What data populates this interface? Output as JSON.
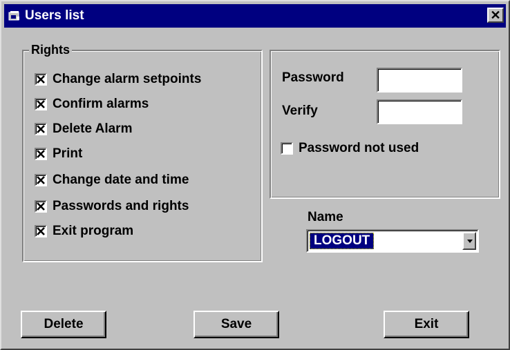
{
  "window": {
    "title": "Users list",
    "close_label": "✕",
    "title_icon": "window-app-icon"
  },
  "rights": {
    "legend": "Rights",
    "items": [
      {
        "label": "Change alarm setpoints",
        "checked": true
      },
      {
        "label": "Confirm alarms",
        "checked": true
      },
      {
        "label": "Delete Alarm",
        "checked": true
      },
      {
        "label": "Print",
        "checked": true
      },
      {
        "label": "Change date and time",
        "checked": true
      },
      {
        "label": "Passwords and rights",
        "checked": true
      },
      {
        "label": "Exit program",
        "checked": true
      }
    ]
  },
  "password": {
    "password_label": "Password",
    "password_value": "",
    "verify_label": "Verify",
    "verify_value": "",
    "not_used_label": "Password not used",
    "not_used_checked": false
  },
  "name": {
    "label": "Name",
    "selected": "LOGOUT"
  },
  "buttons": {
    "delete": "Delete",
    "save": "Save",
    "exit": "Exit"
  },
  "colors": {
    "titlebar": "#000080",
    "face": "#c0c0c0",
    "selection": "#000080"
  }
}
